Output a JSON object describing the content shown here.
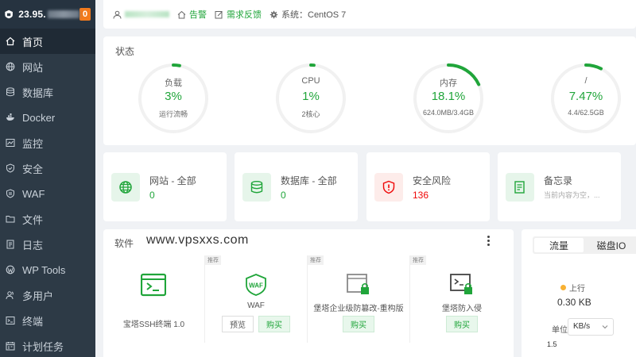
{
  "sidebar": {
    "ip": "23.95.",
    "badge": "0",
    "items": [
      {
        "label": "首页",
        "icon": "home-icon"
      },
      {
        "label": "网站",
        "icon": "globe-icon"
      },
      {
        "label": "数据库",
        "icon": "database-icon"
      },
      {
        "label": "Docker",
        "icon": "docker-icon"
      },
      {
        "label": "监控",
        "icon": "monitor-icon"
      },
      {
        "label": "安全",
        "icon": "shield-icon"
      },
      {
        "label": "WAF",
        "icon": "waf-icon"
      },
      {
        "label": "文件",
        "icon": "folder-icon"
      },
      {
        "label": "日志",
        "icon": "log-icon"
      },
      {
        "label": "WP Tools",
        "icon": "wordpress-icon"
      },
      {
        "label": "多用户",
        "icon": "users-icon"
      },
      {
        "label": "终端",
        "icon": "terminal-icon"
      },
      {
        "label": "计划任务",
        "icon": "schedule-icon"
      }
    ]
  },
  "topbar": {
    "alert": "告警",
    "feedback": "需求反馈",
    "system": "系统：CentOS 7"
  },
  "status": {
    "title": "状态",
    "gauges": [
      {
        "label": "负载",
        "value": "3%",
        "sub": "运行流畅",
        "percent": 3
      },
      {
        "label": "CPU",
        "value": "1%",
        "sub": "2核心",
        "percent": 1
      },
      {
        "label": "内存",
        "value": "18.1%",
        "sub": "624.0MB/3.4GB",
        "percent": 18.1
      },
      {
        "label": "/",
        "value": "7.47%",
        "sub": "4.4/62.5GB",
        "percent": 7.47
      }
    ]
  },
  "cards": [
    {
      "title": "网站 - 全部",
      "value": "0"
    },
    {
      "title": "数据库 - 全部",
      "value": "0"
    },
    {
      "title": "安全风险",
      "value": "136"
    },
    {
      "title": "备忘录",
      "value": "当前内容为空，..."
    }
  ],
  "software": {
    "title": "软件",
    "watermark": "www.vpsxxs.com",
    "tag": "推荐",
    "items": [
      {
        "name": "宝塔SSH终端 1.0"
      },
      {
        "name": "WAF",
        "preview": "预览",
        "buy": "购买"
      },
      {
        "name": "堡塔企业级防篡改-重构版",
        "buy": "购买"
      },
      {
        "name": "堡塔防入侵",
        "buy": "购买"
      }
    ]
  },
  "traffic": {
    "tab_flow": "流量",
    "tab_disk": "磁盘IO",
    "up_label": "上行",
    "up_value": "0.30 KB",
    "unit_label": "单位",
    "unit_value": "KB/s",
    "axis_top": "1.5"
  },
  "colors": {
    "accent": "#20a53a",
    "sidebar": "#2d3a46",
    "warning": "#f37b1d",
    "danger": "#ef0808"
  }
}
